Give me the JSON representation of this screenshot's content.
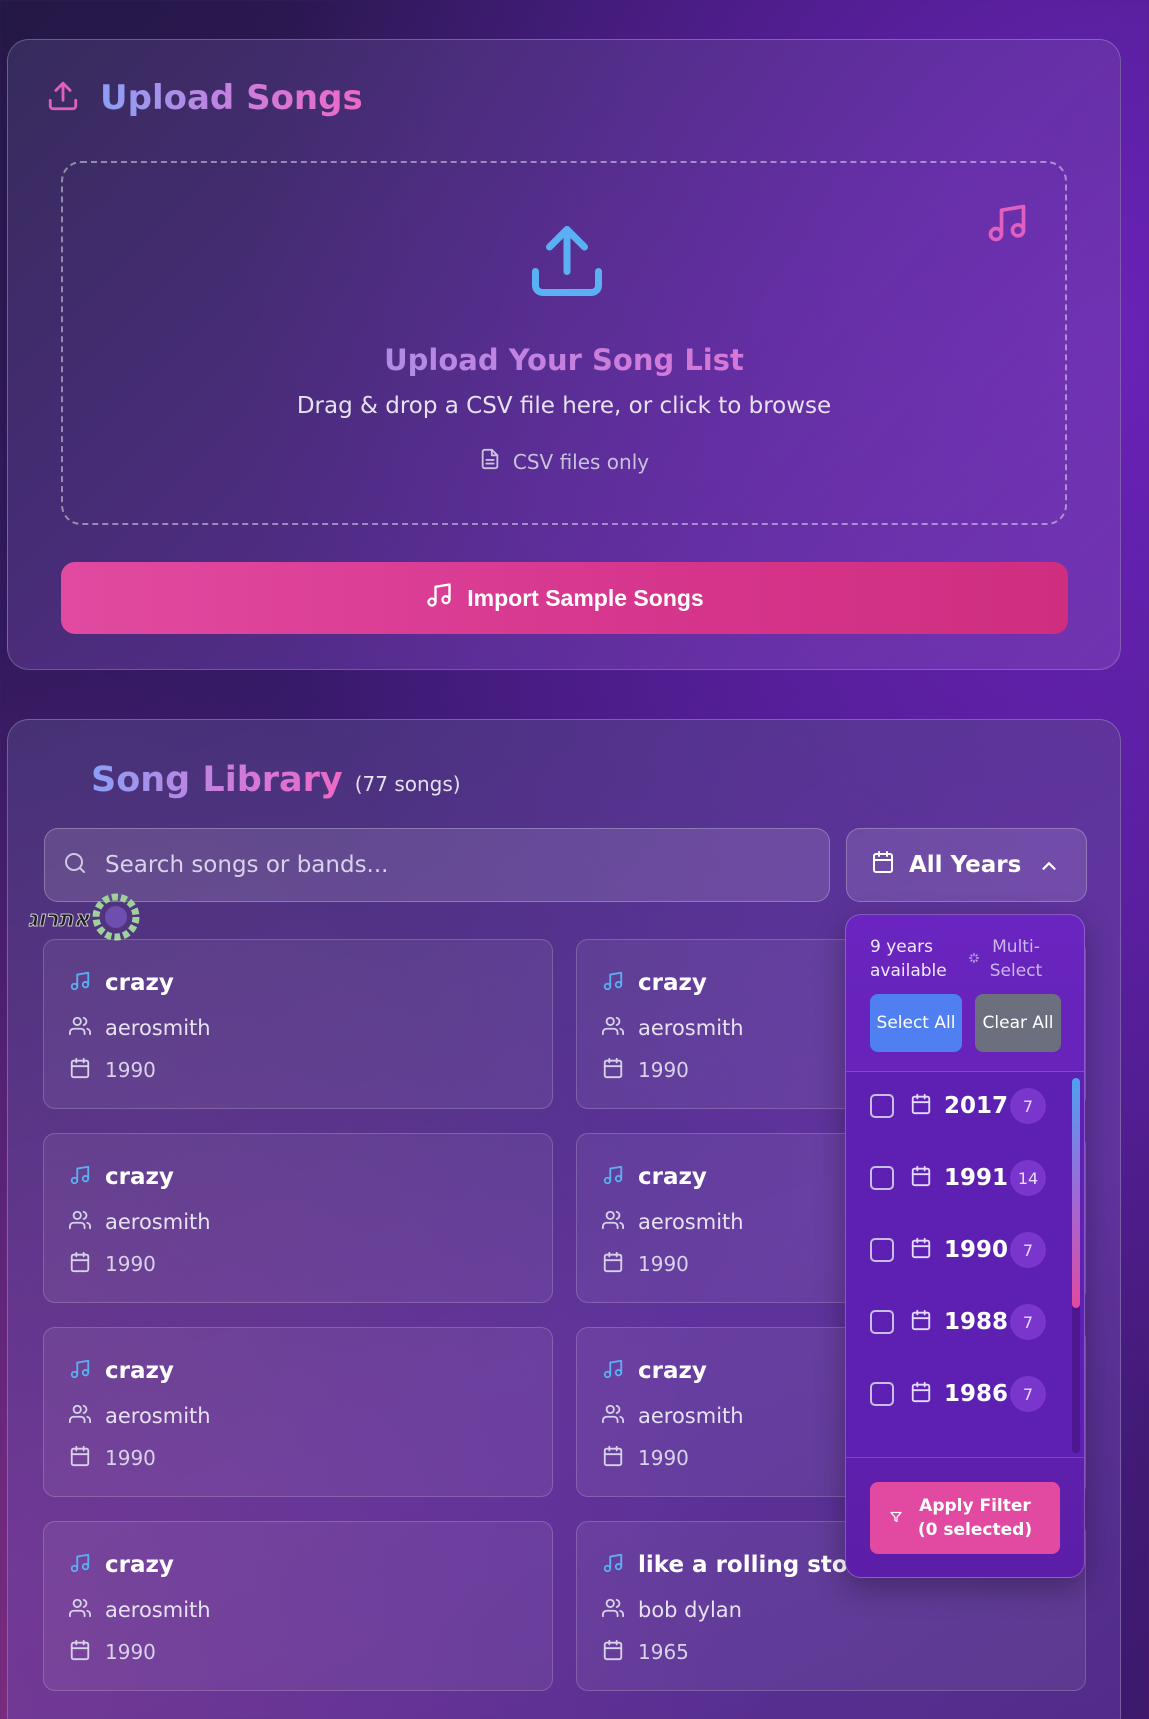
{
  "upload": {
    "title": "Upload Songs",
    "dropzone_title": "Upload Your Song List",
    "dropzone_desc": "Drag & drop a CSV file here, or click to browse",
    "csv_note": "CSV files only",
    "import_button": "Import Sample Songs"
  },
  "library": {
    "title": "Song Library",
    "count": "(77 songs)",
    "search_placeholder": "Search songs or bands...",
    "year_filter_label": "All Years",
    "watermark": "אתרוג"
  },
  "songs": [
    {
      "title": "crazy",
      "artist": "aerosmith",
      "year": "1990"
    },
    {
      "title": "crazy",
      "artist": "aerosmith",
      "year": "1990"
    },
    {
      "title": "crazy",
      "artist": "aerosmith",
      "year": "1990"
    },
    {
      "title": "crazy",
      "artist": "aerosmith",
      "year": "1990"
    },
    {
      "title": "crazy",
      "artist": "aerosmith",
      "year": "1990"
    },
    {
      "title": "crazy",
      "artist": "aerosmith",
      "year": "1990"
    },
    {
      "title": "crazy",
      "artist": "aerosmith",
      "year": "1990"
    },
    {
      "title": "like a rolling stone",
      "artist": "bob dylan",
      "year": "1965"
    }
  ],
  "year_dropdown": {
    "available": "9 years available",
    "multi_select": "Multi-Select",
    "select_all": "Select All",
    "clear_all": "Clear All",
    "years": [
      {
        "year": "2017",
        "count": "7"
      },
      {
        "year": "1991",
        "count": "14"
      },
      {
        "year": "1990",
        "count": "7"
      },
      {
        "year": "1988",
        "count": "7"
      },
      {
        "year": "1986",
        "count": "7"
      }
    ],
    "apply_button": "Apply Filter (0 selected)"
  },
  "colors": {
    "accent_pink": "#e14aa0",
    "accent_blue": "#4f7ff0",
    "icon_blue": "#5ab0f2",
    "icon_pink": "#e060c0"
  },
  "icons": [
    "upload-icon",
    "music-note-icon",
    "file-icon",
    "search-icon",
    "calendar-icon",
    "chevron-up-icon",
    "users-icon",
    "sparkle-icon",
    "filter-icon"
  ]
}
